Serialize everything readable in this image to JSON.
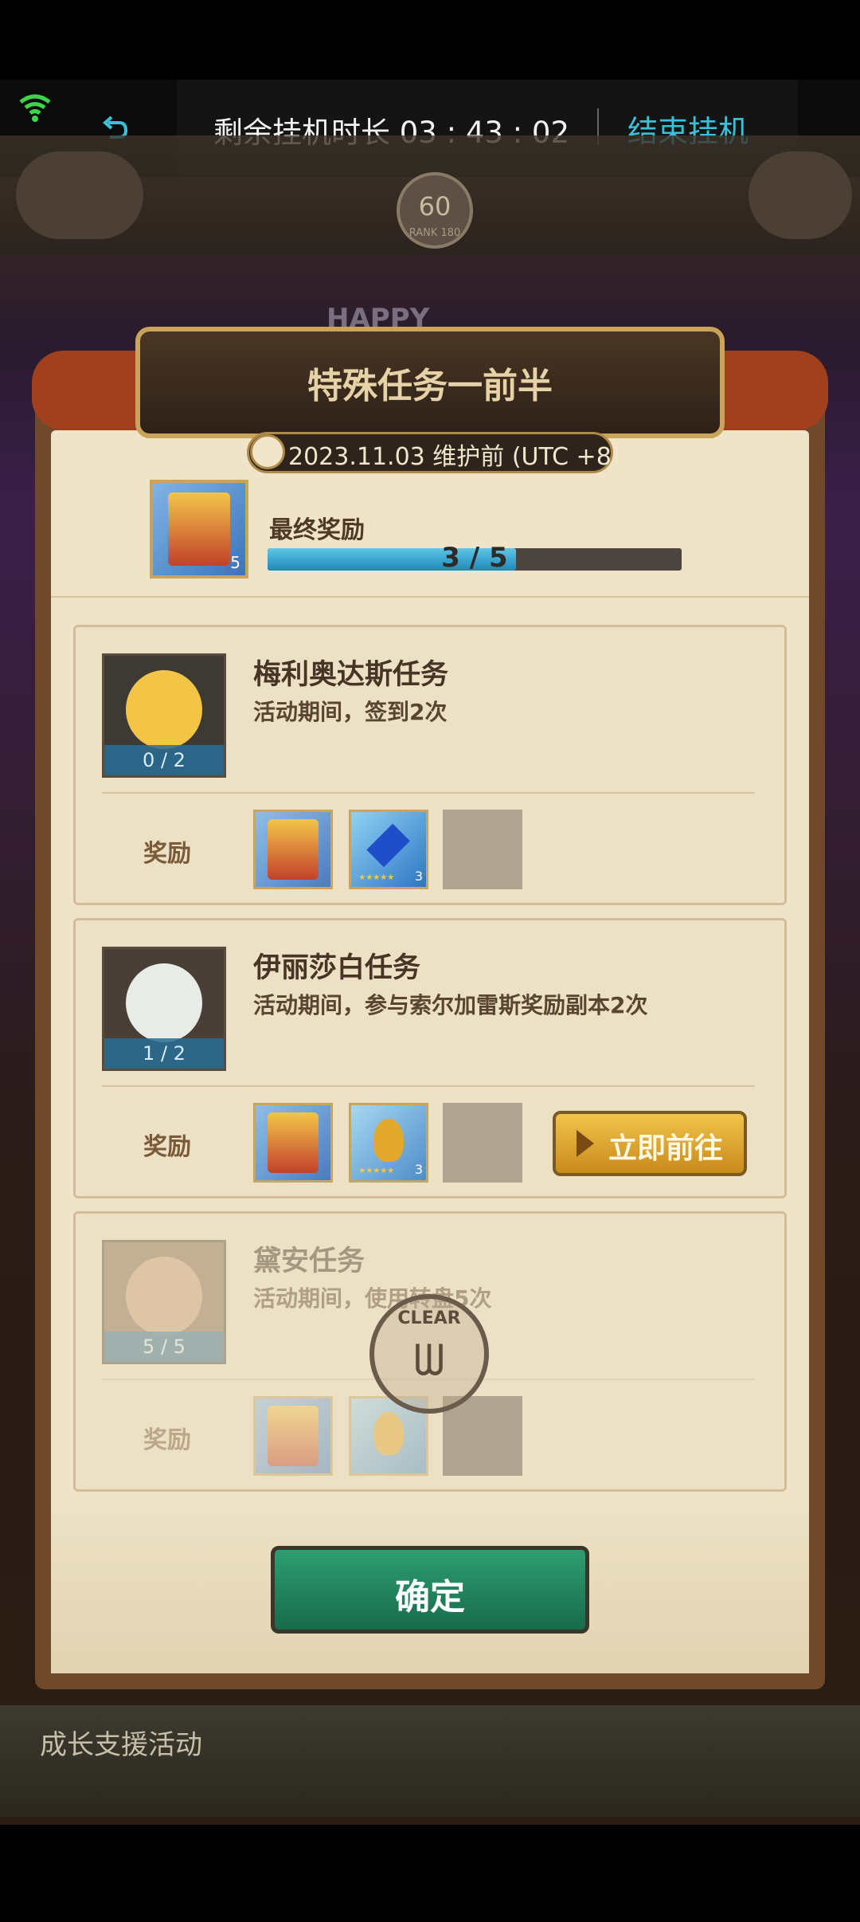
{
  "status_bar": {
    "hang_time_label": "剩余挂机时长 03 : 43 : 02",
    "end_button_label": "结束挂机",
    "accent_color": "#39c1d8"
  },
  "hud": {
    "level": "60",
    "level_sub": "RANK 180"
  },
  "background_text": "HAPPY",
  "dialog": {
    "title": "特殊任务一前半",
    "date_label": "2023.11.03 维护前 (UTC +8)",
    "final_reward": {
      "label": "最终奖励",
      "progress_text": "3 / 5",
      "progress_value": 3,
      "progress_max": 5,
      "item_count": "5"
    },
    "quests": [
      {
        "title": "梅利奥达斯任务",
        "description": "活动期间，签到2次",
        "progress": "0 / 2",
        "reward_label": "奖励",
        "rewards": [
          {
            "type": "card",
            "count": ""
          },
          {
            "type": "gem",
            "count": "3"
          },
          {
            "type": "empty"
          }
        ],
        "completed": false,
        "has_go_button": false
      },
      {
        "title": "伊丽莎白任务",
        "description": "活动期间，参与索尔加雷斯奖励副本2次",
        "progress": "1 / 2",
        "reward_label": "奖励",
        "rewards": [
          {
            "type": "card",
            "count": ""
          },
          {
            "type": "potion",
            "count": "3"
          },
          {
            "type": "empty"
          }
        ],
        "completed": false,
        "has_go_button": true,
        "go_button_label": "立即前往"
      },
      {
        "title": "黛安任务",
        "description": "活动期间，使用转盘5次",
        "progress": "5 / 5",
        "reward_label": "奖励",
        "rewards": [
          {
            "type": "card",
            "count": ""
          },
          {
            "type": "potion",
            "count": ""
          },
          {
            "type": "empty"
          }
        ],
        "completed": true,
        "stamp_text": "CLEAR",
        "has_go_button": false
      }
    ],
    "confirm_label": "确定"
  },
  "bottom_label": "成长支援活动"
}
